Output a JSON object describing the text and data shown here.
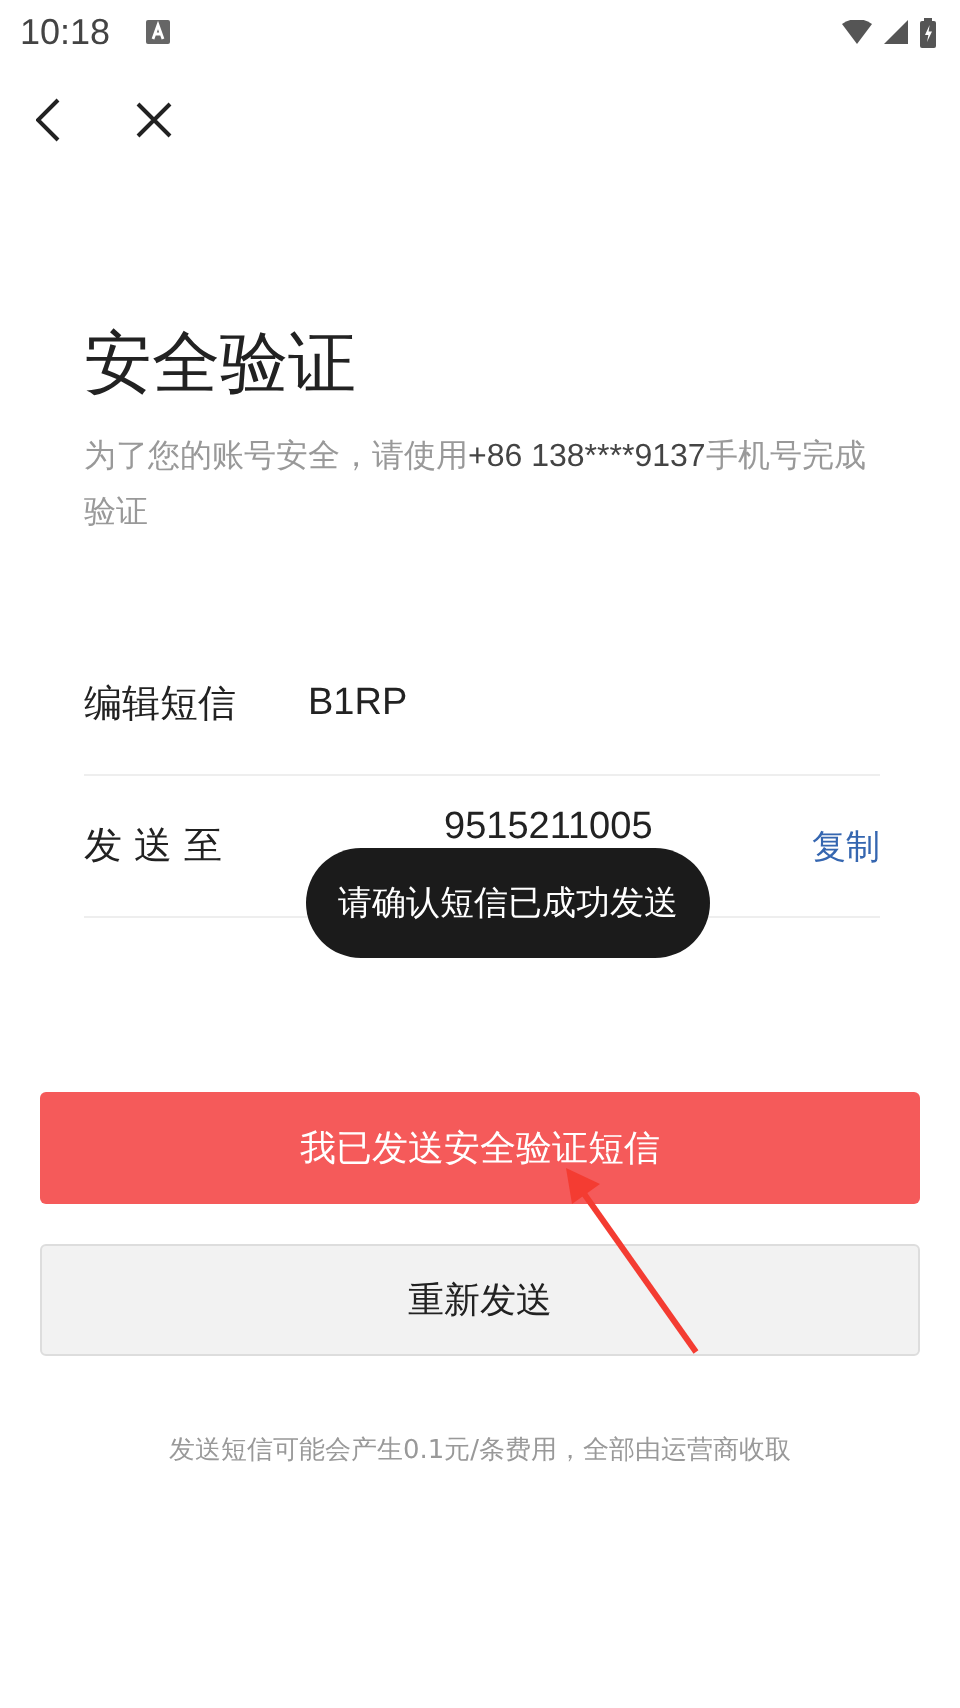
{
  "status_bar": {
    "time": "10:18"
  },
  "title": "安全验证",
  "subtitle": {
    "before": "为了您的账号安全，请使用",
    "phone": "+86 138****9137",
    "after": "手机号完成验证"
  },
  "rows": [
    {
      "label": "编辑短信",
      "value": "B1RP"
    },
    {
      "label": "发 送 至",
      "value": "9515211005",
      "action": "复制"
    }
  ],
  "toast": "请确认短信已成功发送",
  "primary_button": "我已发送安全验证短信",
  "secondary_button": "重新发送",
  "footer": "发送短信可能会产生0.1元/条费用，全部由运营商收取"
}
